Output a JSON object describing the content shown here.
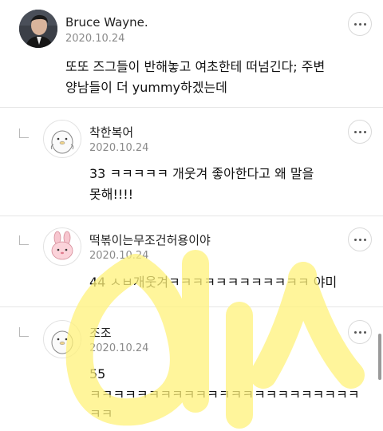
{
  "comments": [
    {
      "author": "Bruce Wayne.",
      "date": "2020.10.24",
      "lines": [
        "또또 즈그들이 반해놓고 여초한테 떠넘긴다; 주변",
        "양남들이 더 yummy하겠는데"
      ],
      "avatar_icon": "profile-photo-icon"
    },
    {
      "author": "착한복어",
      "date": "2020.10.24",
      "lines": [
        "33 ㅋㅋㅋㅋㅋ 개웃겨 좋아한다고 왜 말을",
        "못해!!!!"
      ],
      "avatar_icon": "penguin-drawing-icon"
    },
    {
      "author": "떡볶이는무조건허용이야",
      "date": "2020.10.24",
      "lines": [
        "44 ㅅㅂ개웃겨ㅋㅋㅋㅋㅋㅋㅋㅋㅋㅋㅋㅋ 야미"
      ],
      "avatar_icon": "pink-bunny-drawing-icon"
    },
    {
      "author": "조조",
      "date": "2020.10.24",
      "lines": [
        "55",
        "ㅋㅋㅋㅋㅋㅋㅋㅋㅋㅋㅋㅋㅋㅋㅋㅋㅋㅋㅋㅋㅋㅋㅋ",
        "ㅋㅋ"
      ],
      "avatar_icon": "penguin-drawing-icon"
    }
  ],
  "more_icon": "more-options-icon",
  "reply_icon": "reply-arrow-icon",
  "colors": {
    "watermark": "#fff27a",
    "date": "#8a8a8a",
    "divider": "#e6e6e6"
  }
}
